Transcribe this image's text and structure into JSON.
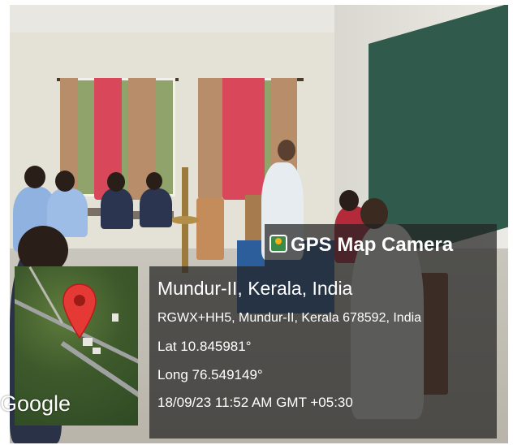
{
  "overlay": {
    "app_title": "GPS Map Camera",
    "place": "Mundur-II, Kerala, India",
    "address": "RGWX+HH5, Mundur-II, Kerala 678592, India",
    "latitude": "Lat 10.845981°",
    "longitude": "Long 76.549149°",
    "timestamp": "18/09/23 11:52 AM GMT +05:30"
  },
  "map": {
    "provider_logo": "Google",
    "pin_icon": "map-pin-icon",
    "pin_color": "#e53935"
  },
  "colors": {
    "overlay_bg": "#222222",
    "text": "#ffffff",
    "chalkboard": "#2f5a4c",
    "curtain": "#d9475a"
  }
}
